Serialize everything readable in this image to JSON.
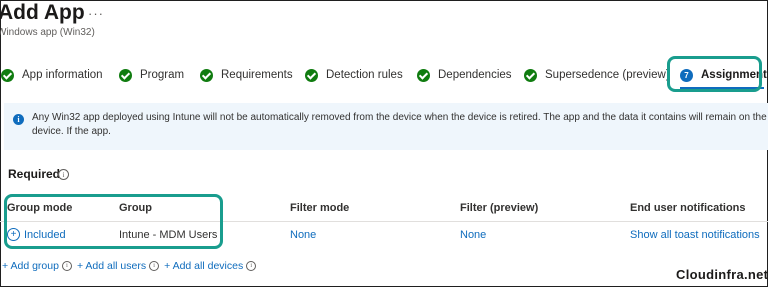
{
  "header": {
    "title": "Add App",
    "more": "···",
    "subtitle": "Windows app (Win32)"
  },
  "steps": [
    {
      "label": "App information",
      "state": "done"
    },
    {
      "label": "Program",
      "state": "done"
    },
    {
      "label": "Requirements",
      "state": "done"
    },
    {
      "label": "Detection rules",
      "state": "done"
    },
    {
      "label": "Dependencies",
      "state": "done"
    },
    {
      "label": "Supersedence (preview)",
      "state": "done"
    },
    {
      "label": "Assignments",
      "state": "active",
      "number": "7"
    }
  ],
  "info_banner": {
    "icon": "i",
    "text": "Any Win32 app deployed using Intune will not be automatically removed from the device when the device is retired. The app and the data it contains will remain on the device. If the app."
  },
  "section": {
    "title": "Required",
    "info_icon": "i"
  },
  "table": {
    "headers": [
      "Group mode",
      "Group",
      "Filter mode",
      "Filter (preview)",
      "End user notifications"
    ],
    "row": {
      "group_mode": "Included",
      "group": "Intune - MDM Users",
      "filter_mode": "None",
      "filter_preview": "None",
      "notifications": "Show all toast notifications"
    }
  },
  "add_links": {
    "add_group": "+ Add group",
    "add_all_users": "+ Add all users",
    "add_all_devices": "+ Add all devices",
    "info_icon": "i"
  },
  "watermark": "Cloudinfra.net",
  "colors": {
    "accent": "#0f6cbd",
    "success": "#107c10",
    "highlight": "#199d8e",
    "banner": "#eff6fc"
  }
}
